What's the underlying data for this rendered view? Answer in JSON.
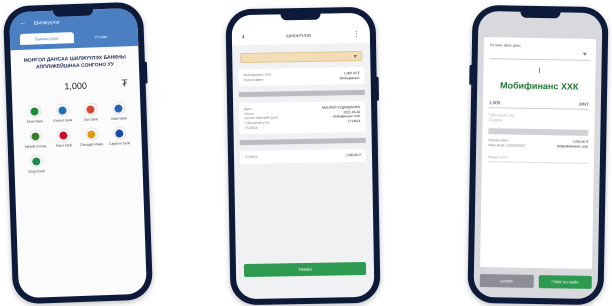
{
  "phone1": {
    "header_title": "Шилжүүлэг",
    "tabs": [
      "Банкны данс",
      "Утсаар"
    ],
    "transfer_title": "МОНГОЛ ДАНСАА ШИЛЖҮҮЛЭХ БАНКНЫ АППЛИКЕЙШНАА СОНГОНО УУ",
    "amount": "1,000",
    "currency_symbol": "₮",
    "banks": [
      {
        "name": "Khan bank",
        "color": "#1d8a3a"
      },
      {
        "name": "Golomt bank",
        "color": "#1f6fb5"
      },
      {
        "name": "Xac bank",
        "color": "#d6452f"
      },
      {
        "name": "State bank",
        "color": "#2563b8"
      },
      {
        "name": "Mbank money",
        "color": "#3a7d2a"
      },
      {
        "name": "Trans bank",
        "color": "#c8102e"
      },
      {
        "name": "Chinggis khaan",
        "color": "#e09a1a"
      },
      {
        "name": "Capitron bank",
        "color": "#1a4aa0"
      },
      {
        "name": "Bogd bank",
        "color": "#1f8a4c"
      }
    ]
  },
  "phone2": {
    "top_title": "ШИЛЖҮҮЛЭХ",
    "card1": [
      {
        "l": "Мобифинанс ХХК",
        "r": "1,000.00 ₮"
      },
      {
        "l": "хүлээн авагч",
        "r": "Мобифинанс"
      }
    ],
    "card2": [
      {
        "l": "Данс",
        "r": "МОНПЕЙ ХУДАЛДААНЫ"
      },
      {
        "l": "Огноо",
        "r": "2021-03-10"
      },
      {
        "l": "Хүлээн авагчийн данс",
        "r": "Мобифинанс ХХК"
      },
      {
        "l": "Гүйлгээний утга",
        "r": "2714614"
      },
      {
        "l": "2714614",
        "r": ""
      }
    ],
    "card3": [
      {
        "l": "2714614",
        "r": "1,000.00 ₮"
      }
    ],
    "button_label": "ТӨЛӨХ"
  },
  "phone3": {
    "select_label": "Хүлээн авах данс",
    "cursor": "I",
    "recipient_name": "Мобифинанс ХХК",
    "amount": "1,000",
    "currency": "MNT",
    "faint_label": "Гүйлгээний утга",
    "faint_value": "2714614",
    "detail_rows": [
      {
        "l": "Хүлээн авагч",
        "r": "1,000.00 ₮"
      },
      {
        "l": "State Bank | 5035305337",
        "r": "МОБИФИНАНС ХХК"
      }
    ],
    "note_placeholder": "Нэмэлт утга",
    "cancel_label": "БОЛИХ",
    "confirm_label": "ГҮЙЛГЭЭ ХИЙХ"
  }
}
